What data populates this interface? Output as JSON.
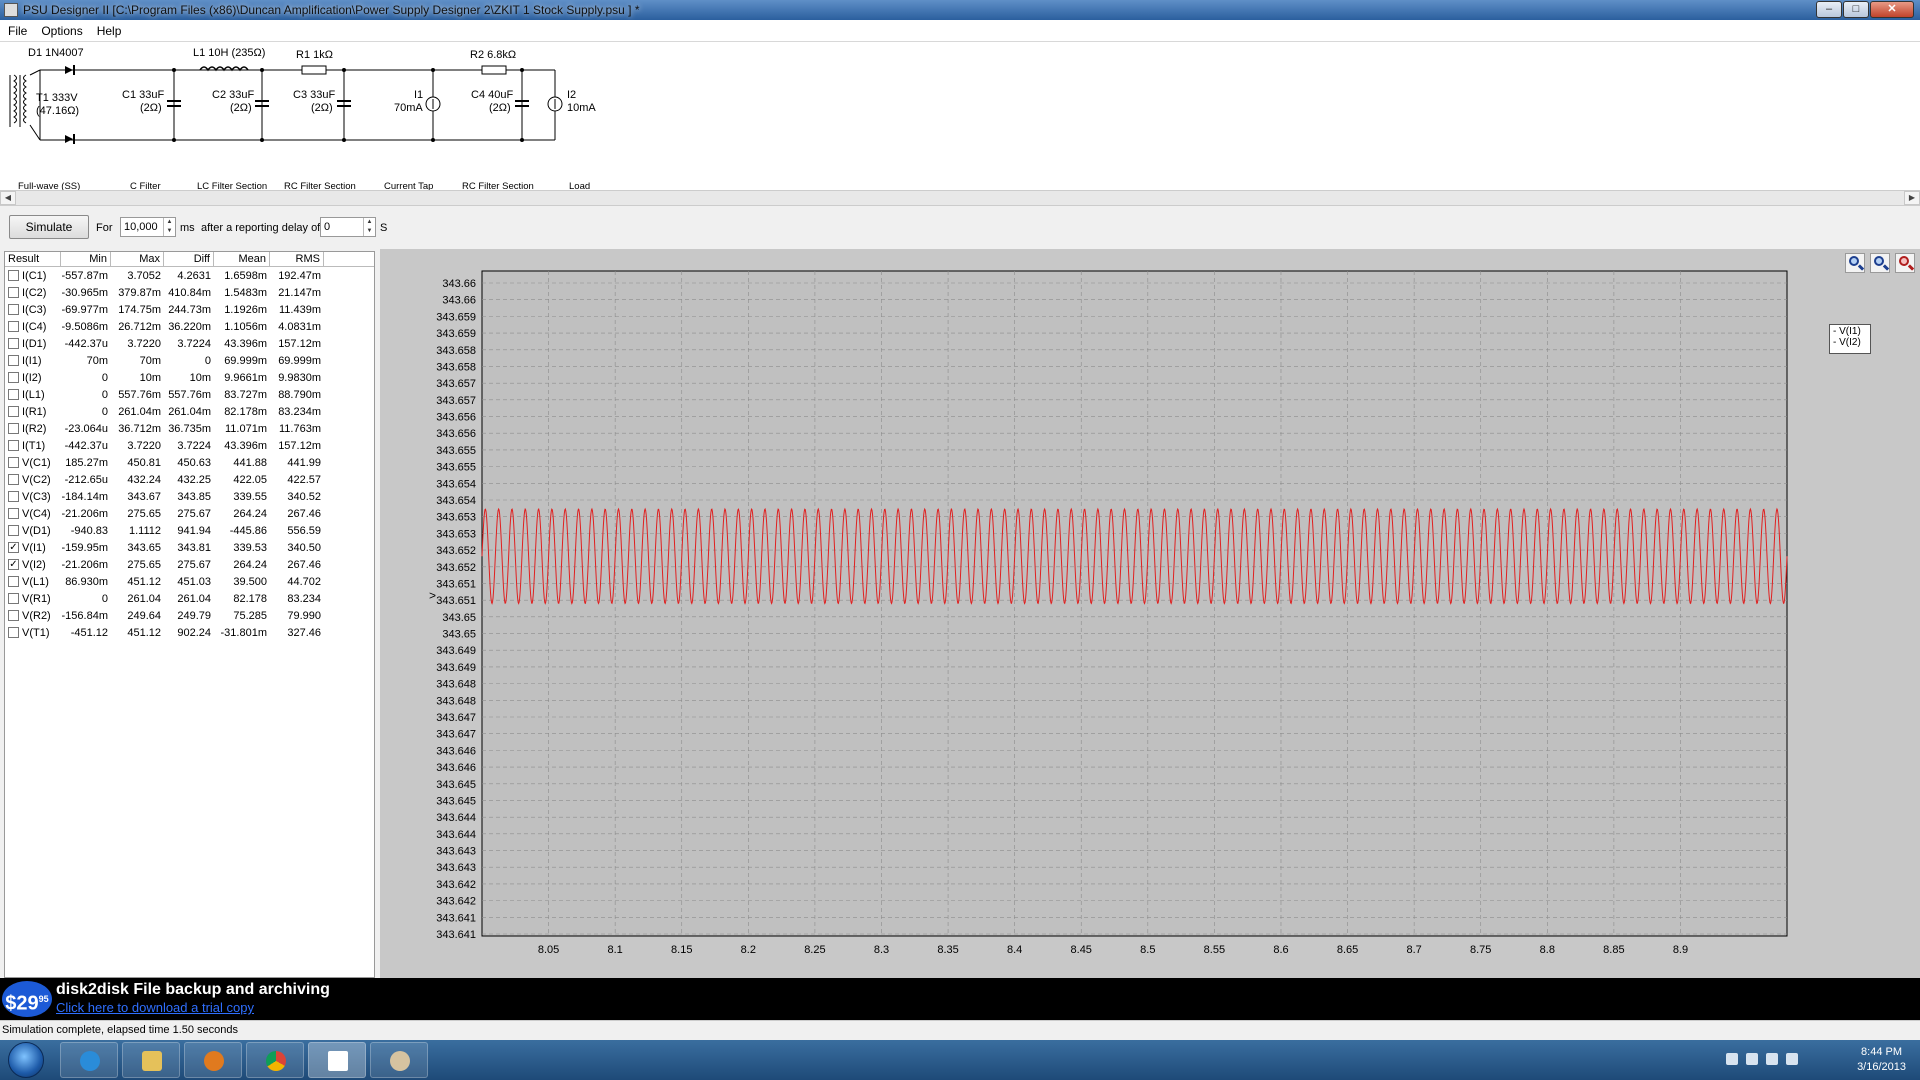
{
  "window": {
    "title": "PSU Designer II  [C:\\Program Files (x86)\\Duncan Amplification\\Power Supply Designer 2\\ZKIT 1 Stock Supply.psu ] *",
    "buttons": [
      "minimize",
      "maximize",
      "close"
    ]
  },
  "menu": [
    "File",
    "Options",
    "Help"
  ],
  "schematic": {
    "components": [
      {
        "id": "D1",
        "label": "D1 1N4007"
      },
      {
        "id": "T1",
        "label": "T1 333V",
        "sub": "(47.16Ω)"
      },
      {
        "id": "L1",
        "label": "L1 10H (235Ω)"
      },
      {
        "id": "R1",
        "label": "R1 1kΩ"
      },
      {
        "id": "R2",
        "label": "R2 6.8kΩ"
      },
      {
        "id": "C1",
        "label": "C1 33uF",
        "sub": "(2Ω)"
      },
      {
        "id": "C2",
        "label": "C2 33uF",
        "sub": "(2Ω)"
      },
      {
        "id": "C3",
        "label": "C3 33uF",
        "sub": "(2Ω)"
      },
      {
        "id": "I1",
        "label": "I1",
        "sub": "70mA"
      },
      {
        "id": "C4",
        "label": "C4 40uF",
        "sub": "(2Ω)"
      },
      {
        "id": "I2",
        "label": "I2",
        "sub": "10mA"
      }
    ],
    "sections": [
      "Full-wave (SS)",
      "C Filter",
      "LC Filter Section",
      "RC Filter Section",
      "Current Tap",
      "RC Filter Section",
      "Load"
    ]
  },
  "simulate": {
    "button": "Simulate",
    "for_label": "For",
    "duration": "10,000",
    "unit_ms": "ms",
    "delay_label": "after a reporting delay of",
    "delay": "0",
    "unit_s": "S"
  },
  "results": {
    "columns": [
      "Result",
      "Min",
      "Max",
      "Diff",
      "Mean",
      "RMS"
    ],
    "rows": [
      {
        "name": "I(C1)",
        "min": "-557.87m",
        "max": "3.7052",
        "diff": "4.2631",
        "mean": "1.6598m",
        "rms": "192.47m",
        "checked": false
      },
      {
        "name": "I(C2)",
        "min": "-30.965m",
        "max": "379.87m",
        "diff": "410.84m",
        "mean": "1.5483m",
        "rms": "21.147m",
        "checked": false
      },
      {
        "name": "I(C3)",
        "min": "-69.977m",
        "max": "174.75m",
        "diff": "244.73m",
        "mean": "1.1926m",
        "rms": "11.439m",
        "checked": false
      },
      {
        "name": "I(C4)",
        "min": "-9.5086m",
        "max": "26.712m",
        "diff": "36.220m",
        "mean": "1.1056m",
        "rms": "4.0831m",
        "checked": false
      },
      {
        "name": "I(D1)",
        "min": "-442.37u",
        "max": "3.7220",
        "diff": "3.7224",
        "mean": "43.396m",
        "rms": "157.12m",
        "checked": false
      },
      {
        "name": "I(I1)",
        "min": "70m",
        "max": "70m",
        "diff": "0",
        "mean": "69.999m",
        "rms": "69.999m",
        "checked": false
      },
      {
        "name": "I(I2)",
        "min": "0",
        "max": "10m",
        "diff": "10m",
        "mean": "9.9661m",
        "rms": "9.9830m",
        "checked": false
      },
      {
        "name": "I(L1)",
        "min": "0",
        "max": "557.76m",
        "diff": "557.76m",
        "mean": "83.727m",
        "rms": "88.790m",
        "checked": false
      },
      {
        "name": "I(R1)",
        "min": "0",
        "max": "261.04m",
        "diff": "261.04m",
        "mean": "82.178m",
        "rms": "83.234m",
        "checked": false
      },
      {
        "name": "I(R2)",
        "min": "-23.064u",
        "max": "36.712m",
        "diff": "36.735m",
        "mean": "11.071m",
        "rms": "11.763m",
        "checked": false
      },
      {
        "name": "I(T1)",
        "min": "-442.37u",
        "max": "3.7220",
        "diff": "3.7224",
        "mean": "43.396m",
        "rms": "157.12m",
        "checked": false
      },
      {
        "name": "V(C1)",
        "min": "185.27m",
        "max": "450.81",
        "diff": "450.63",
        "mean": "441.88",
        "rms": "441.99",
        "checked": false
      },
      {
        "name": "V(C2)",
        "min": "-212.65u",
        "max": "432.24",
        "diff": "432.25",
        "mean": "422.05",
        "rms": "422.57",
        "checked": false
      },
      {
        "name": "V(C3)",
        "min": "-184.14m",
        "max": "343.67",
        "diff": "343.85",
        "mean": "339.55",
        "rms": "340.52",
        "checked": false
      },
      {
        "name": "V(C4)",
        "min": "-21.206m",
        "max": "275.65",
        "diff": "275.67",
        "mean": "264.24",
        "rms": "267.46",
        "checked": false
      },
      {
        "name": "V(D1)",
        "min": "-940.83",
        "max": "1.1112",
        "diff": "941.94",
        "mean": "-445.86",
        "rms": "556.59",
        "checked": false
      },
      {
        "name": "V(I1)",
        "min": "-159.95m",
        "max": "343.65",
        "diff": "343.81",
        "mean": "339.53",
        "rms": "340.50",
        "checked": true
      },
      {
        "name": "V(I2)",
        "min": "-21.206m",
        "max": "275.65",
        "diff": "275.67",
        "mean": "264.24",
        "rms": "267.46",
        "checked": true
      },
      {
        "name": "V(L1)",
        "min": "86.930m",
        "max": "451.12",
        "diff": "451.03",
        "mean": "39.500",
        "rms": "44.702",
        "checked": false
      },
      {
        "name": "V(R1)",
        "min": "0",
        "max": "261.04",
        "diff": "261.04",
        "mean": "82.178",
        "rms": "83.234",
        "checked": false
      },
      {
        "name": "V(R2)",
        "min": "-156.84m",
        "max": "249.64",
        "diff": "249.79",
        "mean": "75.285",
        "rms": "79.990",
        "checked": false
      },
      {
        "name": "V(T1)",
        "min": "-451.12",
        "max": "451.12",
        "diff": "902.24",
        "mean": "-31.801m",
        "rms": "327.46",
        "checked": false
      }
    ]
  },
  "chart_data": {
    "type": "line",
    "title": "",
    "xlabel": "",
    "ylabel": "",
    "xlim": [
      8.0,
      8.98
    ],
    "ylim": [
      343.641,
      343.66
    ],
    "x_ticks": [
      "8.05",
      "8.1",
      "8.15",
      "8.2",
      "8.25",
      "8.3",
      "8.35",
      "8.4",
      "8.45",
      "8.5",
      "8.55",
      "8.6",
      "8.65",
      "8.7",
      "8.75",
      "8.8",
      "8.85",
      "8.9"
    ],
    "y_ticks": [
      "343.66",
      "343.66",
      "343.659",
      "343.659",
      "343.658",
      "343.658",
      "343.657",
      "343.657",
      "343.656",
      "343.656",
      "343.655",
      "343.655",
      "343.654",
      "343.654",
      "343.653",
      "343.653",
      "343.652",
      "343.652",
      "343.651",
      "343.651",
      "343.65",
      "343.65",
      "343.649",
      "343.649",
      "343.648",
      "343.648",
      "343.647",
      "343.647",
      "343.646",
      "343.646",
      "343.645",
      "343.645",
      "343.644",
      "343.644",
      "343.643",
      "343.643",
      "343.642",
      "343.642",
      "343.641",
      "343.641"
    ],
    "grid": true,
    "legend": [
      "V(I1)",
      "V(I2)"
    ],
    "series": [
      {
        "name": "V(I1)",
        "color": "#e02020",
        "waveform": "sine",
        "frequency_hz": 100,
        "y_min": 343.6505,
        "y_max": 343.6532
      }
    ]
  },
  "ad": {
    "price": "$29",
    "price_cents": "95",
    "title": "disk2disk File backup and archiving",
    "link": "Click here to download a trial copy"
  },
  "status": "Simulation complete, elapsed time 1.50 seconds",
  "taskbar": {
    "time": "8:44 PM",
    "date": "3/16/2013"
  }
}
